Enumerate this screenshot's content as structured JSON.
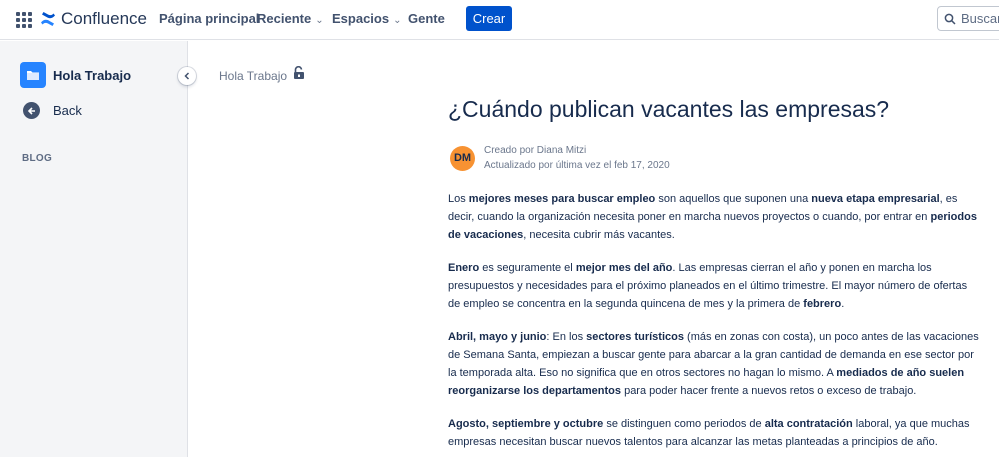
{
  "topnav": {
    "app_name": "Confluence",
    "home": "Página principal",
    "recent": "Reciente",
    "spaces": "Espacios",
    "people": "Gente",
    "create": "Crear",
    "search_placeholder": "Buscar"
  },
  "sidebar": {
    "space_name": "Hola Trabajo",
    "back": "Back",
    "section": "BLOG"
  },
  "breadcrumb": "Hola Trabajo",
  "page": {
    "title": "¿Cuándo publican vacantes las empresas?",
    "author_initials": "DM",
    "created_by": "Creado por Diana Mitzi",
    "updated": "Actualizado por última vez el feb 17, 2020"
  },
  "paragraphs": [
    [
      {
        "t": "Los "
      },
      {
        "t": "mejores meses para buscar empleo",
        "b": true
      },
      {
        "t": " son aquellos que suponen una "
      },
      {
        "t": "nueva etapa empresarial",
        "b": true
      },
      {
        "t": ", es decir, cuando la organización necesita poner en marcha nuevos proyectos o cuando, por entrar en "
      },
      {
        "t": "periodos de vacaciones",
        "b": true
      },
      {
        "t": ", necesita cubrir más vacantes."
      }
    ],
    [
      {
        "t": "Enero",
        "b": true
      },
      {
        "t": " es seguramente el "
      },
      {
        "t": "mejor mes del año",
        "b": true
      },
      {
        "t": ". Las empresas cierran el año y ponen en marcha los presupuestos y necesidades para el próximo planeados en el último trimestre. El mayor número de ofertas de empleo se concentra en la segunda quincena de mes y la primera de "
      },
      {
        "t": "febrero",
        "b": true
      },
      {
        "t": "."
      }
    ],
    [
      {
        "t": "Abril, mayo y junio",
        "b": true
      },
      {
        "t": ": En los "
      },
      {
        "t": "sectores turísticos",
        "b": true
      },
      {
        "t": " (más en zonas con costa), un poco antes de las vacaciones de Semana Santa, empiezan a buscar gente para abarcar a la gran cantidad de demanda en ese sector por la temporada alta. Eso no significa que en otros sectores no hagan lo mismo. A "
      },
      {
        "t": "mediados de año suelen reorganizarse los departamentos",
        "b": true
      },
      {
        "t": " para poder hacer frente a nuevos retos o exceso de trabajo."
      }
    ],
    [
      {
        "t": "Agosto, septiembre y octubre",
        "b": true
      },
      {
        "t": " se distinguen como periodos de "
      },
      {
        "t": "alta contratación",
        "b": true
      },
      {
        "t": " laboral, ya que muchas empresas necesitan buscar nuevos talentos para alcanzar las metas planteadas a principios de año."
      }
    ]
  ],
  "colors": {
    "brand": "#0052cc",
    "avatar": "#f79232",
    "space_icon": "#2684ff"
  },
  "icons": [
    "app-switcher-icon",
    "confluence-logo-icon",
    "chevron-down-icon",
    "search-icon",
    "folder-icon",
    "back-arrow-icon",
    "chevron-left-icon",
    "unlock-icon"
  ]
}
